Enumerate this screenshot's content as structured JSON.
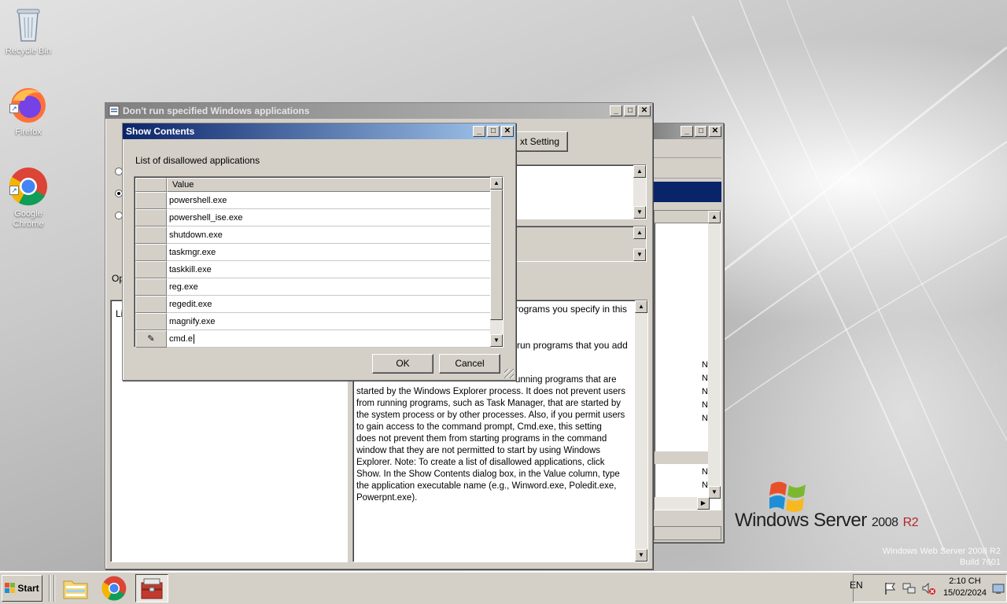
{
  "desktop": {
    "icons": [
      {
        "label": "Recycle Bin"
      },
      {
        "label": "Firefox"
      },
      {
        "label": "Google Chrome"
      }
    ],
    "brand": {
      "name": "Windows Server",
      "version": "2008",
      "edition": "R2"
    },
    "build_lines": [
      "Windows Web Server 2008 R2",
      "Build 7601"
    ]
  },
  "policy_window": {
    "title": "Don't run specified Windows applications",
    "next_setting_label": "xt Setting",
    "options_label": "Op",
    "list_label": "Li",
    "help_fragments": [
      "rograms you specify in this",
      "run programs that you add"
    ],
    "help_lines": [
      "unning programs that are",
      "started by the Windows Explorer process. It does not prevent users",
      "from running programs, such as Task Manager, that are started by",
      "the system process or by other processes. Also, if you permit users",
      "to gain access to the command prompt, Cmd.exe, this setting",
      "does not prevent them from starting programs in the command",
      "window that they are not permitted to start by using Windows",
      "Explorer. Note: To create a list of disallowed applications, click",
      "Show. In the Show Contents dialog box, in the Value column, type",
      "the application executable name (e.g., Winword.exe, Poledit.exe,",
      "Powerpnt.exe)."
    ]
  },
  "back_window": {
    "side_letters": [
      "N",
      "N",
      "N",
      "N",
      "N",
      "N",
      "N"
    ]
  },
  "show_contents": {
    "title": "Show Contents",
    "list_label": "List of disallowed applications",
    "column_header": "Value",
    "rows": [
      "powershell.exe",
      "powershell_ise.exe",
      "shutdown.exe",
      "taskmgr.exe",
      "taskkill.exe",
      "reg.exe",
      "regedit.exe",
      "magnify.exe"
    ],
    "editing_value": "cmd.e",
    "ok_label": "OK",
    "cancel_label": "Cancel"
  },
  "taskbar": {
    "start_label": "Start",
    "language": "EN",
    "time": "2:10 CH",
    "date": "15/02/2024"
  },
  "colors": {
    "titlebar_active": "#0a246a",
    "titlebar_inactive": "#808080",
    "window_face": "#d4d0c8",
    "brand_accent": "#b4262a"
  }
}
